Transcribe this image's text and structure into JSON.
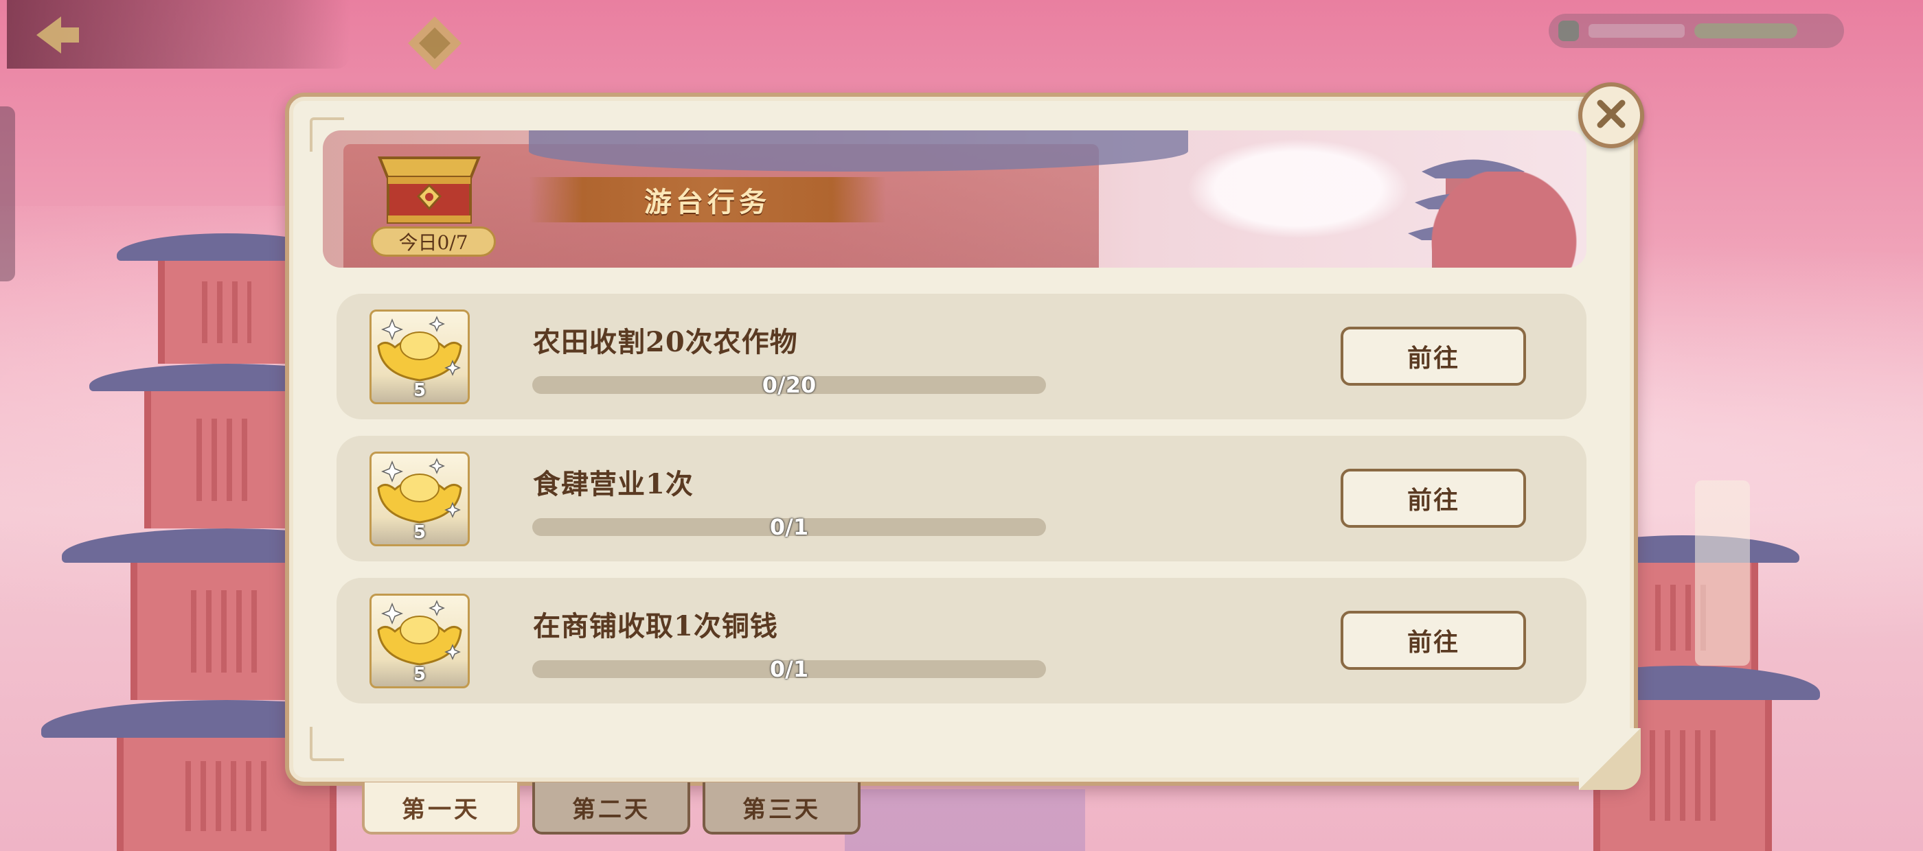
{
  "header": {
    "back_icon": "back-arrow-icon",
    "title": "",
    "emblem_icon": "diamond-emblem-icon"
  },
  "banner": {
    "title": "游台行务",
    "today_label": "今日0/7",
    "chest_icon": "treasure-chest-icon"
  },
  "tasks": [
    {
      "name": "农田收割20次农作物",
      "reward_icon": "gold-ingot-icon",
      "reward_qty": "5",
      "progress_text": "0/20",
      "progress": 0,
      "button_label": "前往"
    },
    {
      "name": "食肆营业1次",
      "reward_icon": "gold-ingot-icon",
      "reward_qty": "5",
      "progress_text": "0/1",
      "progress": 0,
      "button_label": "前往"
    },
    {
      "name": "在商铺收取1次铜钱",
      "reward_icon": "gold-ingot-icon",
      "reward_qty": "5",
      "progress_text": "0/1",
      "progress": 0,
      "button_label": "前往"
    }
  ],
  "day_tabs": [
    {
      "label": "第一天",
      "active": true
    },
    {
      "label": "第二天",
      "active": false
    },
    {
      "label": "第三天",
      "active": false
    }
  ],
  "close_icon": "close-icon",
  "colors": {
    "panel_bg": "#f3eedf",
    "panel_border": "#c7a27a",
    "ribbon": "#b0652f",
    "button_border": "#8a6a44",
    "text_brown": "#5a3a22"
  }
}
